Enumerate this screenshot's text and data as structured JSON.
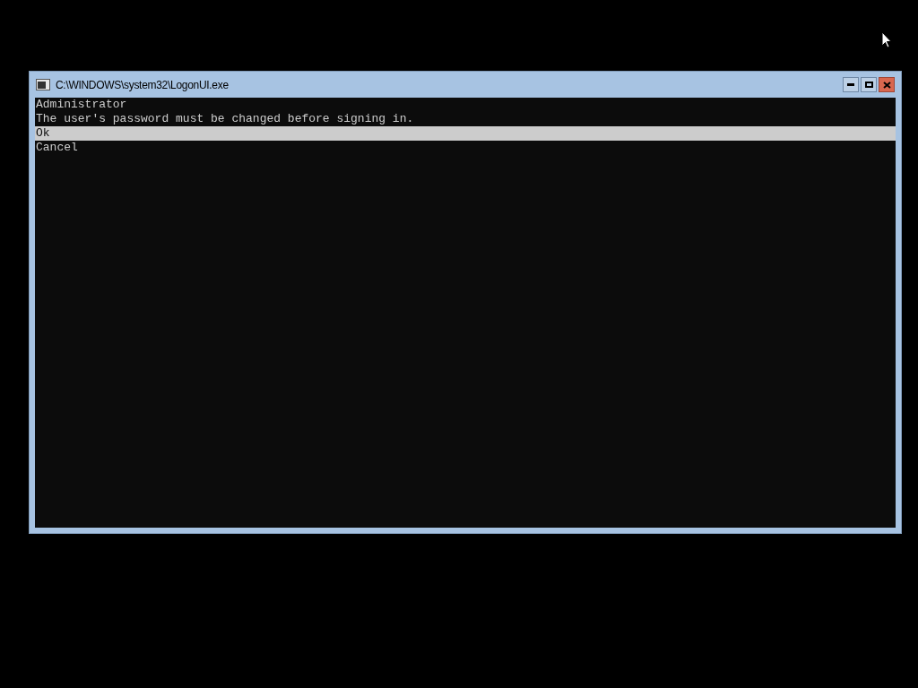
{
  "window": {
    "title": "C:\\WINDOWS\\system32\\LogonUI.exe"
  },
  "console": {
    "lines": [
      "Administrator",
      "The user's password must be changed before signing in."
    ],
    "options": [
      {
        "label": "Ok",
        "selected": true
      },
      {
        "label": "Cancel",
        "selected": false
      }
    ]
  }
}
